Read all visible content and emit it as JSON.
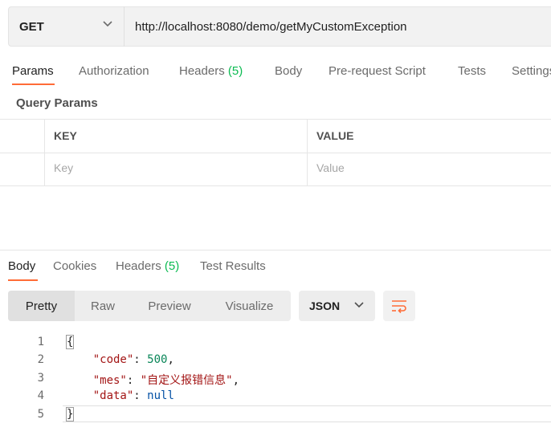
{
  "request": {
    "method": "GET",
    "url": "http://localhost:8080/demo/getMyCustomException"
  },
  "request_tabs": [
    {
      "label": "Params",
      "count": ""
    },
    {
      "label": "Authorization",
      "count": ""
    },
    {
      "label": "Headers",
      "count": "(5)"
    },
    {
      "label": "Body",
      "count": ""
    },
    {
      "label": "Pre-request Script",
      "count": ""
    },
    {
      "label": "Tests",
      "count": ""
    },
    {
      "label": "Settings",
      "count": ""
    }
  ],
  "query_params": {
    "title": "Query Params",
    "columns": [
      "KEY",
      "VALUE"
    ],
    "placeholders": {
      "key": "Key",
      "value": "Value"
    }
  },
  "response_tabs": [
    {
      "label": "Body",
      "count": ""
    },
    {
      "label": "Cookies",
      "count": ""
    },
    {
      "label": "Headers",
      "count": "(5)"
    },
    {
      "label": "Test Results",
      "count": ""
    }
  ],
  "view_modes": [
    "Pretty",
    "Raw",
    "Preview",
    "Visualize"
  ],
  "format": "JSON",
  "code": {
    "line_numbers": [
      "1",
      "2",
      "3",
      "4",
      "5"
    ],
    "open_brace": "{",
    "close_brace": "}",
    "fields": [
      {
        "key": "\"code\"",
        "value": "500",
        "comma": ","
      },
      {
        "key": "\"mes\"",
        "value": "\"自定义报错信息\"",
        "comma": ","
      },
      {
        "key": "\"data\"",
        "value": "null",
        "comma": ""
      }
    ]
  },
  "colors": {
    "accent": "#ff6c37",
    "count": "#0cbb52"
  },
  "icons": {
    "method_dropdown": "chevron-down-icon",
    "format_dropdown": "chevron-down-icon",
    "wrap": "wrap-lines-icon"
  }
}
